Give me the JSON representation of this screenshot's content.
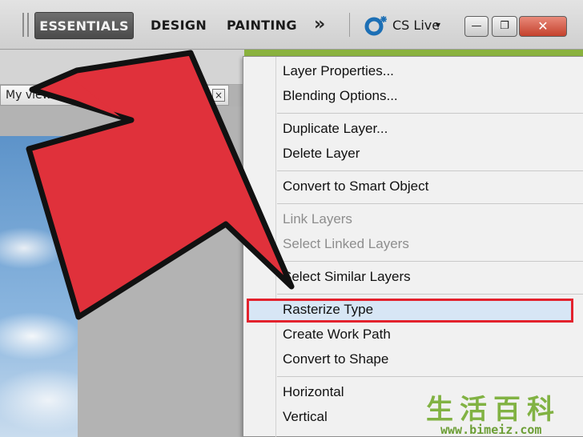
{
  "workspace_bar": {
    "essentials_label": "ESSENTIALS",
    "design_label": "DESIGN",
    "painting_label": "PAINTING",
    "more_label": "»",
    "cs_live_label": "CS Live",
    "dropdown_caret": "▾",
    "minimize_label": "—",
    "restore_label": "❐",
    "close_label": "✕"
  },
  "document_tab": {
    "title": "My view         ning  , RG",
    "close_label": "×"
  },
  "context_menu": {
    "groups": [
      [
        {
          "label": "Layer Properties...",
          "enabled": true
        },
        {
          "label": "Blending Options...",
          "enabled": true
        }
      ],
      [
        {
          "label": "Duplicate Layer...",
          "enabled": true
        },
        {
          "label": "Delete Layer",
          "enabled": true
        }
      ],
      [
        {
          "label": "Convert to Smart Object",
          "enabled": true
        }
      ],
      [
        {
          "label": "Link Layers",
          "enabled": false
        },
        {
          "label": "Select Linked Layers",
          "enabled": false
        }
      ],
      [
        {
          "label": "Select Similar Layers",
          "enabled": true
        }
      ],
      [
        {
          "label": "Rasterize Type",
          "enabled": true,
          "highlighted": true
        },
        {
          "label": "Create Work Path",
          "enabled": true
        },
        {
          "label": "Convert to Shape",
          "enabled": true
        }
      ],
      [
        {
          "label": "Horizontal",
          "enabled": true
        },
        {
          "label": "Vertical",
          "enabled": true
        }
      ]
    ]
  },
  "annotation": {
    "arrow_color": "#e0313b",
    "highlight_color": "#e3222d"
  },
  "watermark": {
    "logo": "生活百科",
    "url": "www.bimeiz.com"
  }
}
